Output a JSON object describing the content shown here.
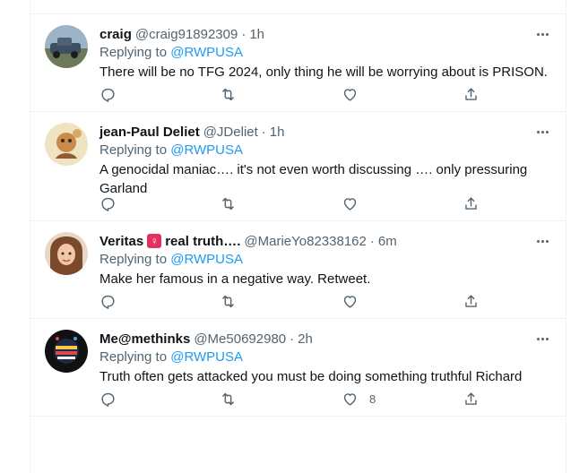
{
  "tweets": [
    {
      "name": "craig",
      "handle": "@craig91892309",
      "time": "1h",
      "replying_prefix": "Replying to ",
      "replying_to": "@RWPUSA",
      "text": "There will be no TFG 2024, only thing he will be worrying about is PRISON.",
      "likes": ""
    },
    {
      "name": "jean-Paul Deliet",
      "handle": "@JDeliet",
      "time": "1h",
      "replying_prefix": "Replying to ",
      "replying_to": "@RWPUSA",
      "text": "A genocidal maniac…. it's not even worth discussing …. only pressuring Garland",
      "likes": ""
    },
    {
      "name": "Veritas",
      "name_emoji": "♀",
      "name_suffix": "real truth….",
      "handle": "@MarieYo82338162",
      "time": "6m",
      "replying_prefix": "Replying to ",
      "replying_to": "@RWPUSA",
      "text": "Make her famous in a negative way. Retweet.",
      "likes": ""
    },
    {
      "name": "Me@methinks",
      "handle": "@Me50692980",
      "time": "2h",
      "replying_prefix": "Replying to ",
      "replying_to": "@RWPUSA",
      "text": "Truth often gets attacked you must be doing something truthful Richard",
      "likes": "8"
    }
  ],
  "separator": "·",
  "icons": {
    "reply": "reply-icon",
    "retweet": "retweet-icon",
    "like": "heart-icon",
    "share": "share-icon",
    "more": "more-icon"
  },
  "colors": {
    "link": "#1d9bf0",
    "secondary": "#536471",
    "text": "#0f1419",
    "divider": "#eff3f4"
  }
}
